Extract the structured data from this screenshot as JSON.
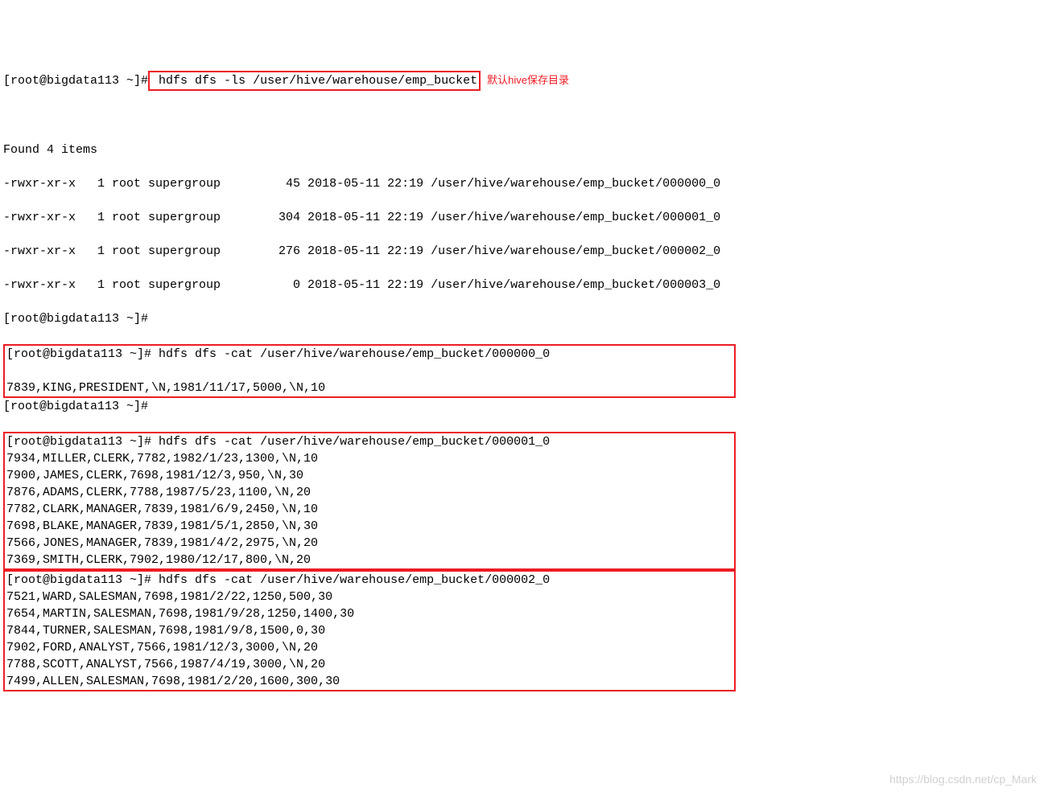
{
  "prompt": "[root@bigdata113 ~]#",
  "cmd_ls": "hdfs dfs -ls /user/hive/warehouse/emp_bucket",
  "annotation_cn": "默认hive保存目录",
  "found_items": "Found 4 items",
  "ls_rows": [
    "-rwxr-xr-x   1 root supergroup         45 2018-05-11 22:19 /user/hive/warehouse/emp_bucket/000000_0",
    "-rwxr-xr-x   1 root supergroup        304 2018-05-11 22:19 /user/hive/warehouse/emp_bucket/000001_0",
    "-rwxr-xr-x   1 root supergroup        276 2018-05-11 22:19 /user/hive/warehouse/emp_bucket/000002_0",
    "-rwxr-xr-x   1 root supergroup          0 2018-05-11 22:19 /user/hive/warehouse/emp_bucket/000003_0"
  ],
  "cmd_cat0": "hdfs dfs -cat /user/hive/warehouse/emp_bucket/000000_0",
  "cat0_rows": [
    "7839,KING,PRESIDENT,\\N,1981/11/17,5000,\\N,10"
  ],
  "cmd_cat1": "hdfs dfs -cat /user/hive/warehouse/emp_bucket/000001_0",
  "cat1_rows": [
    "7934,MILLER,CLERK,7782,1982/1/23,1300,\\N,10",
    "7900,JAMES,CLERK,7698,1981/12/3,950,\\N,30",
    "7876,ADAMS,CLERK,7788,1987/5/23,1100,\\N,20",
    "7782,CLARK,MANAGER,7839,1981/6/9,2450,\\N,10",
    "7698,BLAKE,MANAGER,7839,1981/5/1,2850,\\N,30",
    "7566,JONES,MANAGER,7839,1981/4/2,2975,\\N,20",
    "7369,SMITH,CLERK,7902,1980/12/17,800,\\N,20"
  ],
  "cmd_cat2": "hdfs dfs -cat /user/hive/warehouse/emp_bucket/000002_0",
  "cat2_rows": [
    "7521,WARD,SALESMAN,7698,1981/2/22,1250,500,30",
    "7654,MARTIN,SALESMAN,7698,1981/9/28,1250,1400,30",
    "7844,TURNER,SALESMAN,7698,1981/9/8,1500,0,30",
    "7902,FORD,ANALYST,7566,1981/12/3,3000,\\N,20",
    "7788,SCOTT,ANALYST,7566,1987/4/19,3000,\\N,20",
    "7499,ALLEN,SALESMAN,7698,1981/2/20,1600,300,30"
  ],
  "watermark": "https://blog.csdn.net/cp_Mark"
}
